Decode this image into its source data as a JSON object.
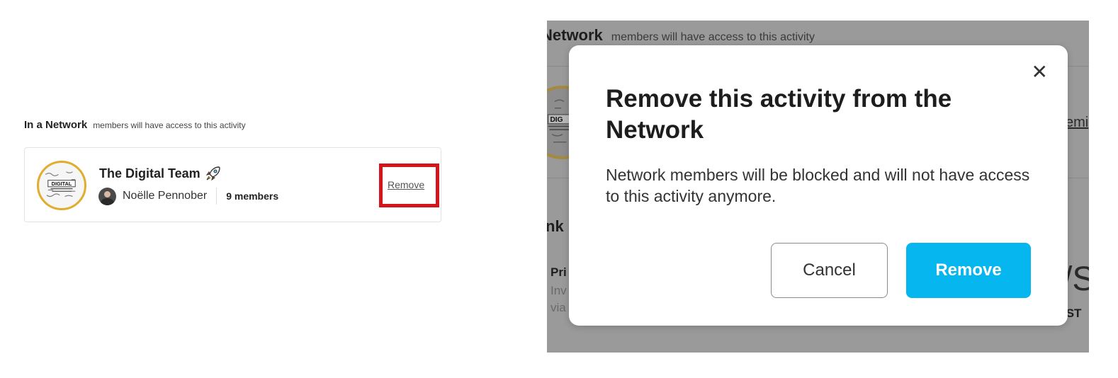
{
  "left_panel": {
    "section": {
      "title": "In a Network",
      "subtitle": "members will have access to this activity"
    },
    "network_card": {
      "logo_text": "DIGITAL",
      "team_name": "The Digital Team",
      "team_icon": "rocket-icon",
      "owner_name": "Noëlle Pennober",
      "members_count": "9 members",
      "remove_label": "Remove",
      "highlight_color": "#d4151c"
    }
  },
  "right_panel": {
    "background": {
      "section_title": "Network",
      "section_subtitle": "members will have access to this activity",
      "fragment_logo": "DIG",
      "fragment_link": "emi",
      "fragment_heading": "nk",
      "fragment_pri": "Pri",
      "fragment_inv": "Inv",
      "fragment_via": "via",
      "fragment_big": "/S",
      "fragment_st": "/ST"
    },
    "modal": {
      "close_icon": "close-icon",
      "title": "Remove this activity from the Network",
      "body": "Network members will be blocked and will not have access to this activity anymore.",
      "cancel_label": "Cancel",
      "remove_label": "Remove",
      "accent_color": "#06b6ee"
    }
  }
}
